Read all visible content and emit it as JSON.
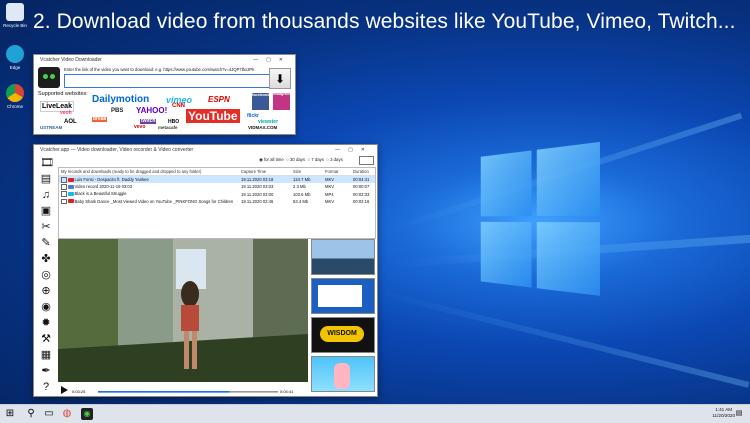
{
  "headline": "2. Download video from thousands websites like YouTube, Vimeo, Twitch...",
  "desktop_icons": [
    {
      "label": "Recycle Bin",
      "icon": "recycle-bin-icon",
      "color": "#dfe8f4"
    },
    {
      "label": "Edge",
      "icon": "edge-icon",
      "color": "#1fa3d6"
    },
    {
      "label": "Chrome",
      "icon": "chrome-icon",
      "color": "#f2b705"
    }
  ],
  "downloader": {
    "title": "Vcatcher Video Downloader",
    "prompt": "Enter the link of the video you want to download: e.g. https://www.youtube.com/watch?v=4JQP7lbx3Pk",
    "url_value": "",
    "supported_label": "Supported websites:",
    "sites": [
      "LiveLeak",
      "Dailymotion",
      "vimeo",
      "ESPN",
      "facebook",
      "instagram",
      "PBS",
      "YAHOO!",
      "CNN",
      "YouTube",
      "flickr",
      "viewster",
      "twitch",
      "vevo",
      "metacafe",
      "VIDMAX.COM",
      "USTREAM",
      "AOL",
      "veoh",
      "break",
      "HBO"
    ]
  },
  "app": {
    "title": "Vcatcher.app — Video downloader, Video recorder & Video converter",
    "filters": [
      "for all time",
      "30 days",
      "7 days",
      "3 days"
    ],
    "selected_filter": "for all time",
    "table_headers": [
      "My records and downloads (ready to be dragged and dropped to any folder)",
      "Capture Time",
      "Size",
      "Format",
      "Duration"
    ],
    "rows": [
      {
        "name": "Luis Fonsi - Despacito ft. Daddy Yankee",
        "time": "19.11.2020 03:18",
        "size": "124.7 Mb",
        "format": "MKV",
        "duration": "00:04:41"
      },
      {
        "name": "Video record 2020-11-19 03:03",
        "time": "19.11.2020 03:03",
        "size": "2.3 Mb",
        "format": "MKV",
        "duration": "00:00:07"
      },
      {
        "name": "Black is a Beautiful Struggle",
        "time": "19.11.2020 03:00",
        "size": "103.6 Mb",
        "format": "MP4",
        "duration": "00:02:33"
      },
      {
        "name": "Baby Shark Dance _Most Viewed Video on YouTube _PINKFONG Songs for Children",
        "time": "19.11.2020 02:46",
        "size": "53.4 Mb",
        "format": "MKV",
        "duration": "00:02:16"
      }
    ],
    "player": {
      "current": "0:03:25",
      "total": "0:04:41",
      "progress": 0.73
    },
    "thumb_text": "WISDOM",
    "toolbar_icons": [
      "film-icon",
      "document-icon",
      "music-icon",
      "video-clip-icon",
      "scissors-icon",
      "magic-wand-icon",
      "puzzle-icon",
      "coin-icon",
      "globe-icon",
      "drive-icon",
      "fire-icon",
      "tool-icon",
      "keyboard-icon",
      "feather-icon",
      "help-icon"
    ]
  },
  "taskbar": {
    "time": "1:41 AM",
    "date": "11/20/2020"
  }
}
